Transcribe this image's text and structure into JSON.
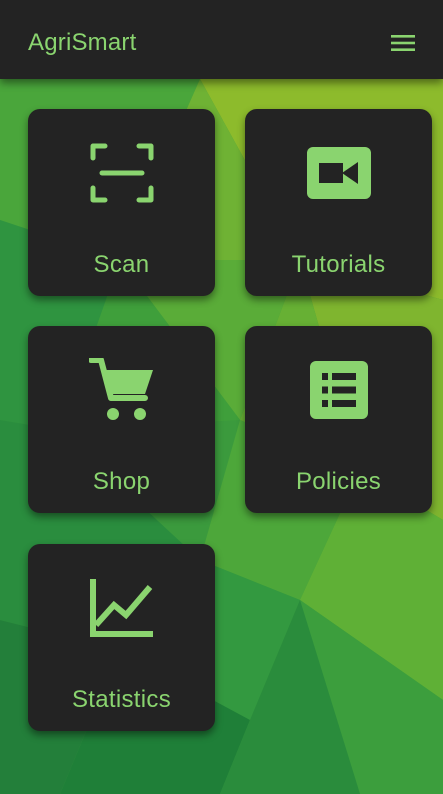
{
  "app": {
    "title": "AgriSmart",
    "accent_color": "#8ad46f",
    "surface_color": "#232323",
    "background_colors": [
      "#2a8f3c",
      "#52a53a",
      "#8bb52a",
      "#1d7a35"
    ]
  },
  "header": {
    "menu_icon": "hamburger-menu-icon"
  },
  "tiles": [
    {
      "label": "Scan",
      "icon": "scan-icon"
    },
    {
      "label": "Tutorials",
      "icon": "video-camera-icon"
    },
    {
      "label": "Shop",
      "icon": "shopping-cart-icon"
    },
    {
      "label": "Policies",
      "icon": "list-document-icon"
    },
    {
      "label": "Statistics",
      "icon": "line-chart-icon"
    }
  ]
}
